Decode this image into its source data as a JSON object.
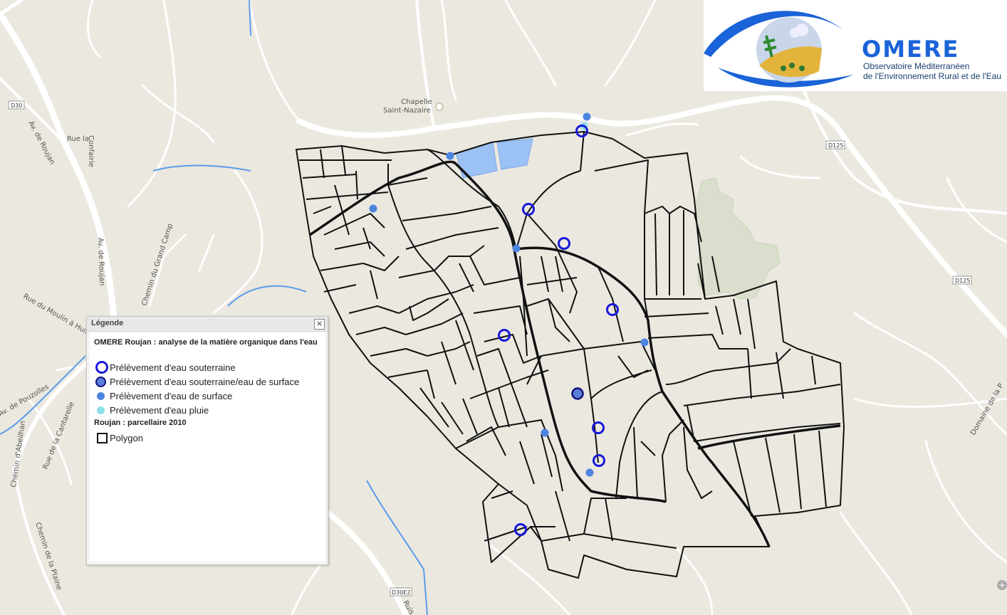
{
  "map": {
    "road_labels": {
      "d30": "D30",
      "d125a": "D125",
      "d125b": "D125",
      "d30e2": "D30E2",
      "chapelle1": "Chapelle",
      "chapelle2": "Saint-Nazaire",
      "av_roujan1": "Av. de Roujan",
      "av_roujan2": "Av. de Roujan",
      "rue_confairie1": "Rue la",
      "rue_confairie2": "Confairie",
      "grand_camp": "Chemin du Grand Camp",
      "moulin": "Rue du Moulin à Huile",
      "pouzolles": "Av. de Pouzolles",
      "abeilhan": "Chemin d'Abeilhan",
      "cantarelle": "Rue de la Cantarelle",
      "plaine": "Chemin de la Plaine",
      "domaine": "Domaine de la P",
      "ruis": "Ruis"
    },
    "colors": {
      "background": "#ebe8e0",
      "roads": "#ffffff",
      "stream": "#5b9ce8",
      "parcel_outline": "#111111",
      "ground_water": "#1818d8",
      "surface_water": "#4d84e0",
      "rain_water": "#8ce0ea",
      "pond": "#9cc2f5",
      "green_area": "#d9dfcc"
    }
  },
  "logo": {
    "title": "OMERE",
    "line1": "Observatoire Méditerranéen",
    "line2": "de l'Environnement Rural et de l'Eau"
  },
  "legend": {
    "header": "Légende",
    "close_label": "×",
    "group1_title": "OMERE Roujan : analyse de la matière organique dans l'eau",
    "items": [
      {
        "label": "Prélèvement d'eau souterraine",
        "icon": "ground-water-ring"
      },
      {
        "label": "Prélèvement d'eau souterraine/eau de surface",
        "icon": "mixed-water-dot"
      },
      {
        "label": "Prélèvement d'eau de surface",
        "icon": "surface-water-dot"
      },
      {
        "label": "Prélèvement d'eau pluie",
        "icon": "rain-water-dot"
      }
    ],
    "group2_title": "Roujan : parcellaire 2010",
    "polygon_label": "Polygon"
  },
  "zoom_plus": "+"
}
